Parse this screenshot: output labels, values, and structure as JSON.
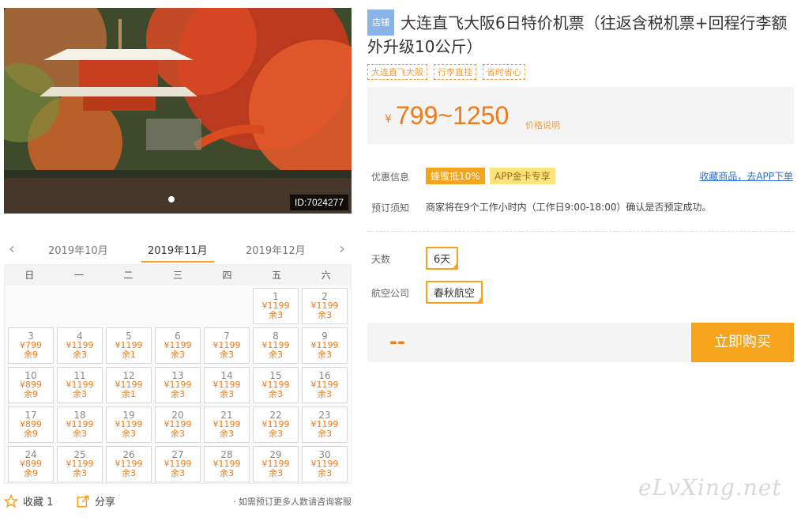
{
  "hero": {
    "image_id": "ID:7024277"
  },
  "months": {
    "prev": "2019年10月",
    "current": "2019年11月",
    "next": "2019年12月"
  },
  "weekdays": [
    "日",
    "一",
    "二",
    "三",
    "四",
    "五",
    "六"
  ],
  "calendar": [
    {
      "day": "1",
      "price": "¥1199",
      "remain": "余3"
    },
    {
      "day": "2",
      "price": "¥1199",
      "remain": "余3"
    },
    {
      "day": "3",
      "price": "¥799",
      "remain": "余9"
    },
    {
      "day": "4",
      "price": "¥1199",
      "remain": "余3"
    },
    {
      "day": "5",
      "price": "¥1199",
      "remain": "余1"
    },
    {
      "day": "6",
      "price": "¥1199",
      "remain": "余3"
    },
    {
      "day": "7",
      "price": "¥1199",
      "remain": "余3"
    },
    {
      "day": "8",
      "price": "¥1199",
      "remain": "余3"
    },
    {
      "day": "9",
      "price": "¥1199",
      "remain": "余3"
    },
    {
      "day": "10",
      "price": "¥899",
      "remain": "余9"
    },
    {
      "day": "11",
      "price": "¥1199",
      "remain": "余3"
    },
    {
      "day": "12",
      "price": "¥1199",
      "remain": "余1"
    },
    {
      "day": "13",
      "price": "¥1199",
      "remain": "余3"
    },
    {
      "day": "14",
      "price": "¥1199",
      "remain": "余3"
    },
    {
      "day": "15",
      "price": "¥1199",
      "remain": "余3"
    },
    {
      "day": "16",
      "price": "¥1199",
      "remain": "余3"
    },
    {
      "day": "17",
      "price": "¥899",
      "remain": "余9"
    },
    {
      "day": "18",
      "price": "¥1199",
      "remain": "余3"
    },
    {
      "day": "19",
      "price": "¥1199",
      "remain": "余3"
    },
    {
      "day": "20",
      "price": "¥1199",
      "remain": "余3"
    },
    {
      "day": "21",
      "price": "¥1199",
      "remain": "余3"
    },
    {
      "day": "22",
      "price": "¥1199",
      "remain": "余3"
    },
    {
      "day": "23",
      "price": "¥1199",
      "remain": "余3"
    },
    {
      "day": "24",
      "price": "¥899",
      "remain": "余9"
    },
    {
      "day": "25",
      "price": "¥1199",
      "remain": "余3"
    },
    {
      "day": "26",
      "price": "¥1199",
      "remain": "余3"
    },
    {
      "day": "27",
      "price": "¥1199",
      "remain": "余3"
    },
    {
      "day": "28",
      "price": "¥1199",
      "remain": "余3"
    },
    {
      "day": "29",
      "price": "¥1199",
      "remain": "余3"
    },
    {
      "day": "30",
      "price": "¥1199",
      "remain": "余3"
    }
  ],
  "footer": {
    "fav_label": "收藏 1",
    "share_label": "分享",
    "consult": "· 如需预订更多人数请咨询客服"
  },
  "product": {
    "shop_tag": "店铺",
    "title": "大连直飞大阪6日特价机票（往返含税机票+回程行李额外升级10公斤）",
    "tags": [
      "大连直飞大阪",
      "行李直挂",
      "省时省心"
    ],
    "yen": "¥",
    "price": "799~1250",
    "price_note": "价格说明"
  },
  "promo": {
    "label": "优惠信息",
    "badge1": "蜂蜜抵10%",
    "badge2": "APP金卡专享",
    "app_link": "收藏商品，去APP下单"
  },
  "notice": {
    "label": "预订须知",
    "text": "商家将在9个工作小时内（工作日9:00-18:00）确认是否预定成功。"
  },
  "options": {
    "days_label": "天数",
    "days_value": "6天",
    "airline_label": "航空公司",
    "airline_value": "春秋航空"
  },
  "buy": {
    "total": "--",
    "button": "立即购买"
  },
  "watermark": "eLvXing.net"
}
